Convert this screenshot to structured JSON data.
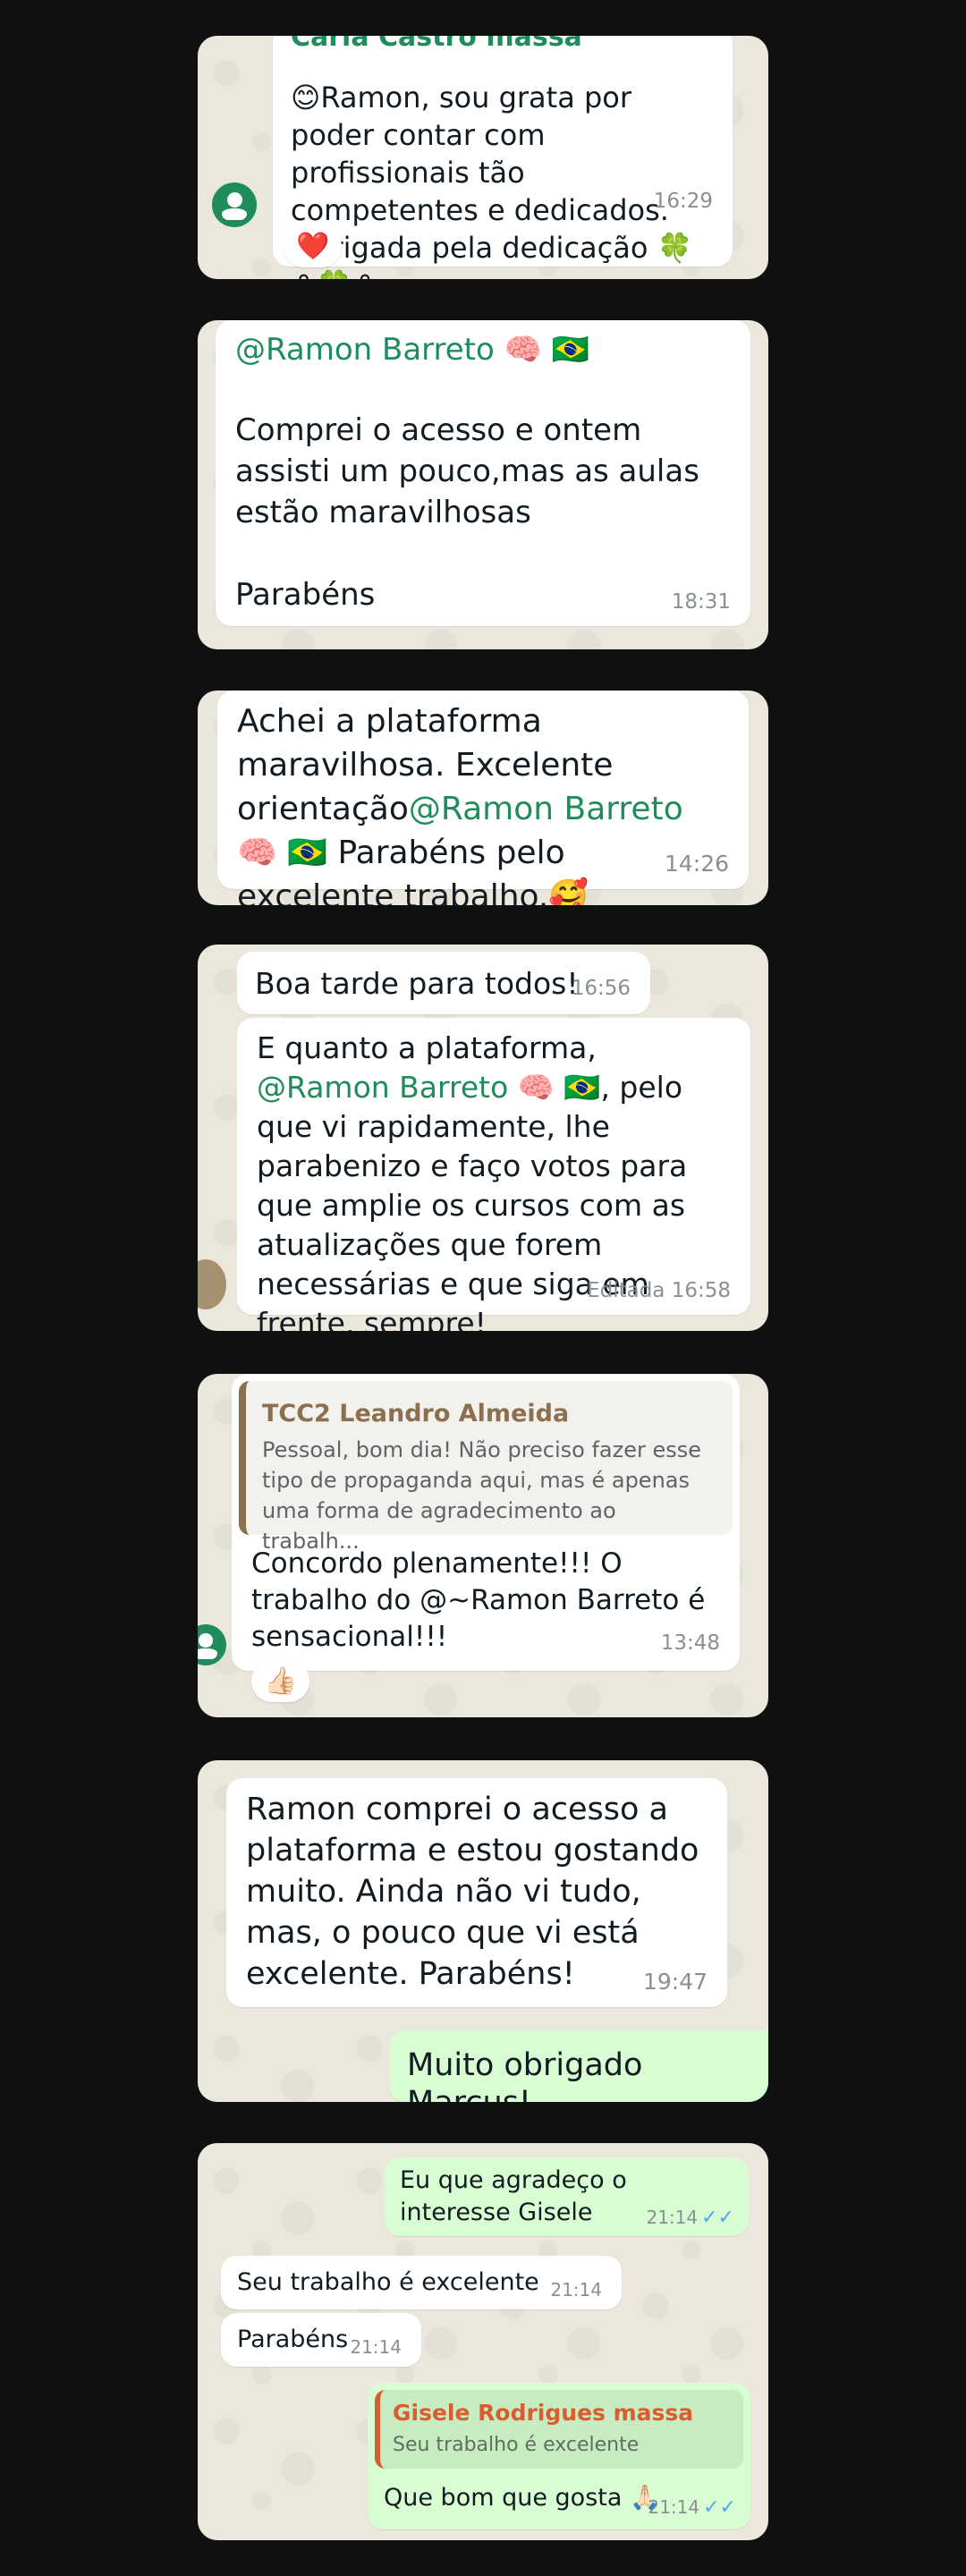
{
  "cards": [
    {
      "sender_partial": "Carla Castro massa",
      "text": "😊Ramon, sou grata por poder contar com profissionais tão competentes e dedicados. Obrigada pela dedicação 🍀⚘🍀⚘",
      "time": "16:29",
      "reaction": "❤️"
    },
    {
      "mention": "@Ramon Barreto 🧠 🇧🇷",
      "text": "Comprei o acesso e ontem assisti um pouco,mas as aulas estão maravilhosas\n\nParabéns",
      "time": "18:31"
    },
    {
      "text_before": "Achei a plataforma maravilhosa. Excelente orientação",
      "mention": "@Ramon Barreto",
      "text_after": " 🧠 🇧🇷 Parabéns pelo excelente trabalho.🥰",
      "time": "14:26"
    },
    {
      "msg1": "Boa tarde para todos!",
      "time1": "16:56",
      "msg2_before": "E quanto a plataforma, ",
      "msg2_mention": "@Ramon Barreto",
      "msg2_after": " 🧠 🇧🇷, pelo que vi rapidamente, lhe parabenizo e faço votos para que amplie os cursos com as atualizações que forem necessárias e que siga em frente, sempre!",
      "edited": "Editada",
      "time2": "16:58"
    },
    {
      "quote_author": "TCC2 Leandro Almeida",
      "quote_text": "Pessoal, bom dia! Não preciso fazer esse tipo de propaganda aqui, mas é apenas uma forma de agradecimento ao trabalh...",
      "text": "Concordo plenamente!!! O trabalho do @~Ramon Barreto é sensacional!!!",
      "time": "13:48",
      "reaction": "👍🏻"
    },
    {
      "text": "Ramon comprei o acesso a plataforma e estou gostando muito. Ainda não vi tudo, mas, o pouco que vi está excelente. Parabéns!",
      "time": "19:47",
      "reply": "Muito obrigado Marcus!"
    },
    {
      "out1": "Eu que agradeço o interesse Gisele",
      "out1_time": "21:14",
      "in1": "Seu trabalho é excelente",
      "in1_time": "21:14",
      "in2": "Parabéns",
      "in2_time": "21:14",
      "quote_author": "Gisele Rodrigues massa",
      "quote_text": "Seu trabalho é excelente",
      "out2": "Que bom que gosta 🙏🏻",
      "out2_time": "21:14",
      "ticks": "✓✓"
    }
  ],
  "colors": {
    "background": "#0f1011",
    "chat_bg": "#ece7dc",
    "incoming": "#ffffff",
    "outgoing": "#d9fdd3",
    "mention": "#1f8c5c",
    "read_ticks": "#4fa8e8"
  }
}
